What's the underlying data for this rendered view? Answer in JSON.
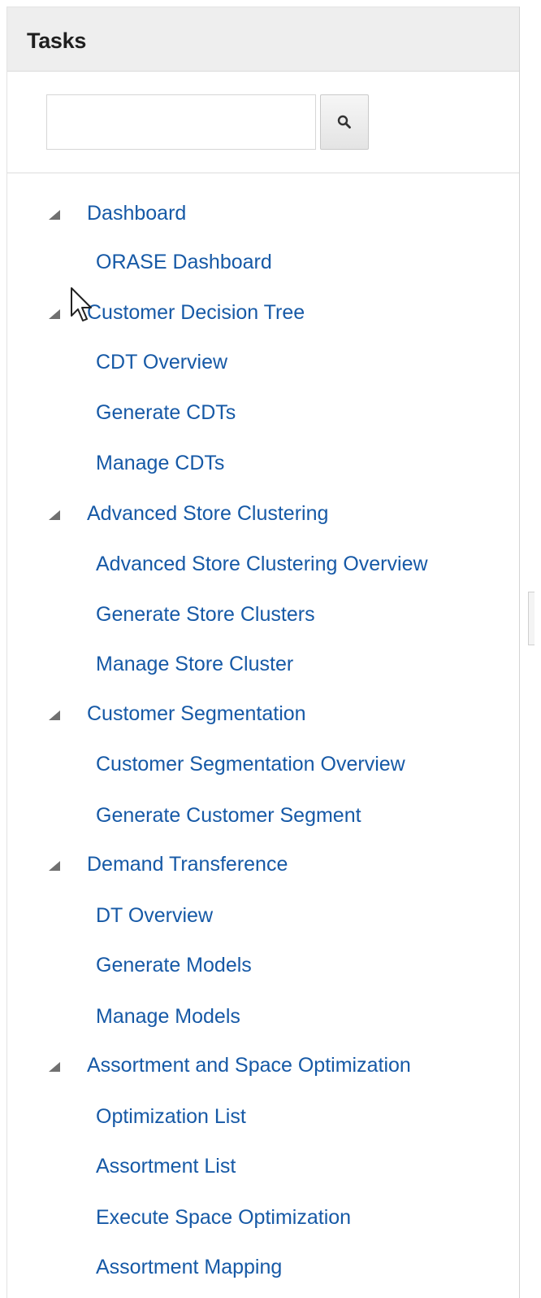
{
  "tasks_panel": {
    "title": "Tasks",
    "search": {
      "value": "",
      "placeholder": ""
    }
  },
  "tree": {
    "groups": [
      {
        "label": "Dashboard",
        "items": [
          "ORASE Dashboard"
        ]
      },
      {
        "label": "Customer Decision Tree",
        "items": [
          "CDT Overview",
          "Generate CDTs",
          "Manage CDTs"
        ]
      },
      {
        "label": "Advanced Store Clustering",
        "items": [
          "Advanced Store Clustering Overview",
          "Generate Store Clusters",
          "Manage Store Cluster"
        ]
      },
      {
        "label": "Customer Segmentation",
        "items": [
          "Customer Segmentation Overview",
          "Generate Customer Segment"
        ]
      },
      {
        "label": "Demand Transference",
        "items": [
          "DT Overview",
          "Generate Models",
          "Manage Models"
        ]
      },
      {
        "label": "Assortment and Space Optimization",
        "items": [
          "Optimization List",
          "Assortment List",
          "Execute Space Optimization",
          "Assortment Mapping"
        ]
      }
    ]
  },
  "icons": {
    "search": "search-icon",
    "expanded": "expanded-triangle-icon",
    "cursor": "mouse-pointer-icon"
  },
  "colors": {
    "link": "#1659a6",
    "header_bg": "#eeeeee",
    "triangle": "#707070"
  }
}
